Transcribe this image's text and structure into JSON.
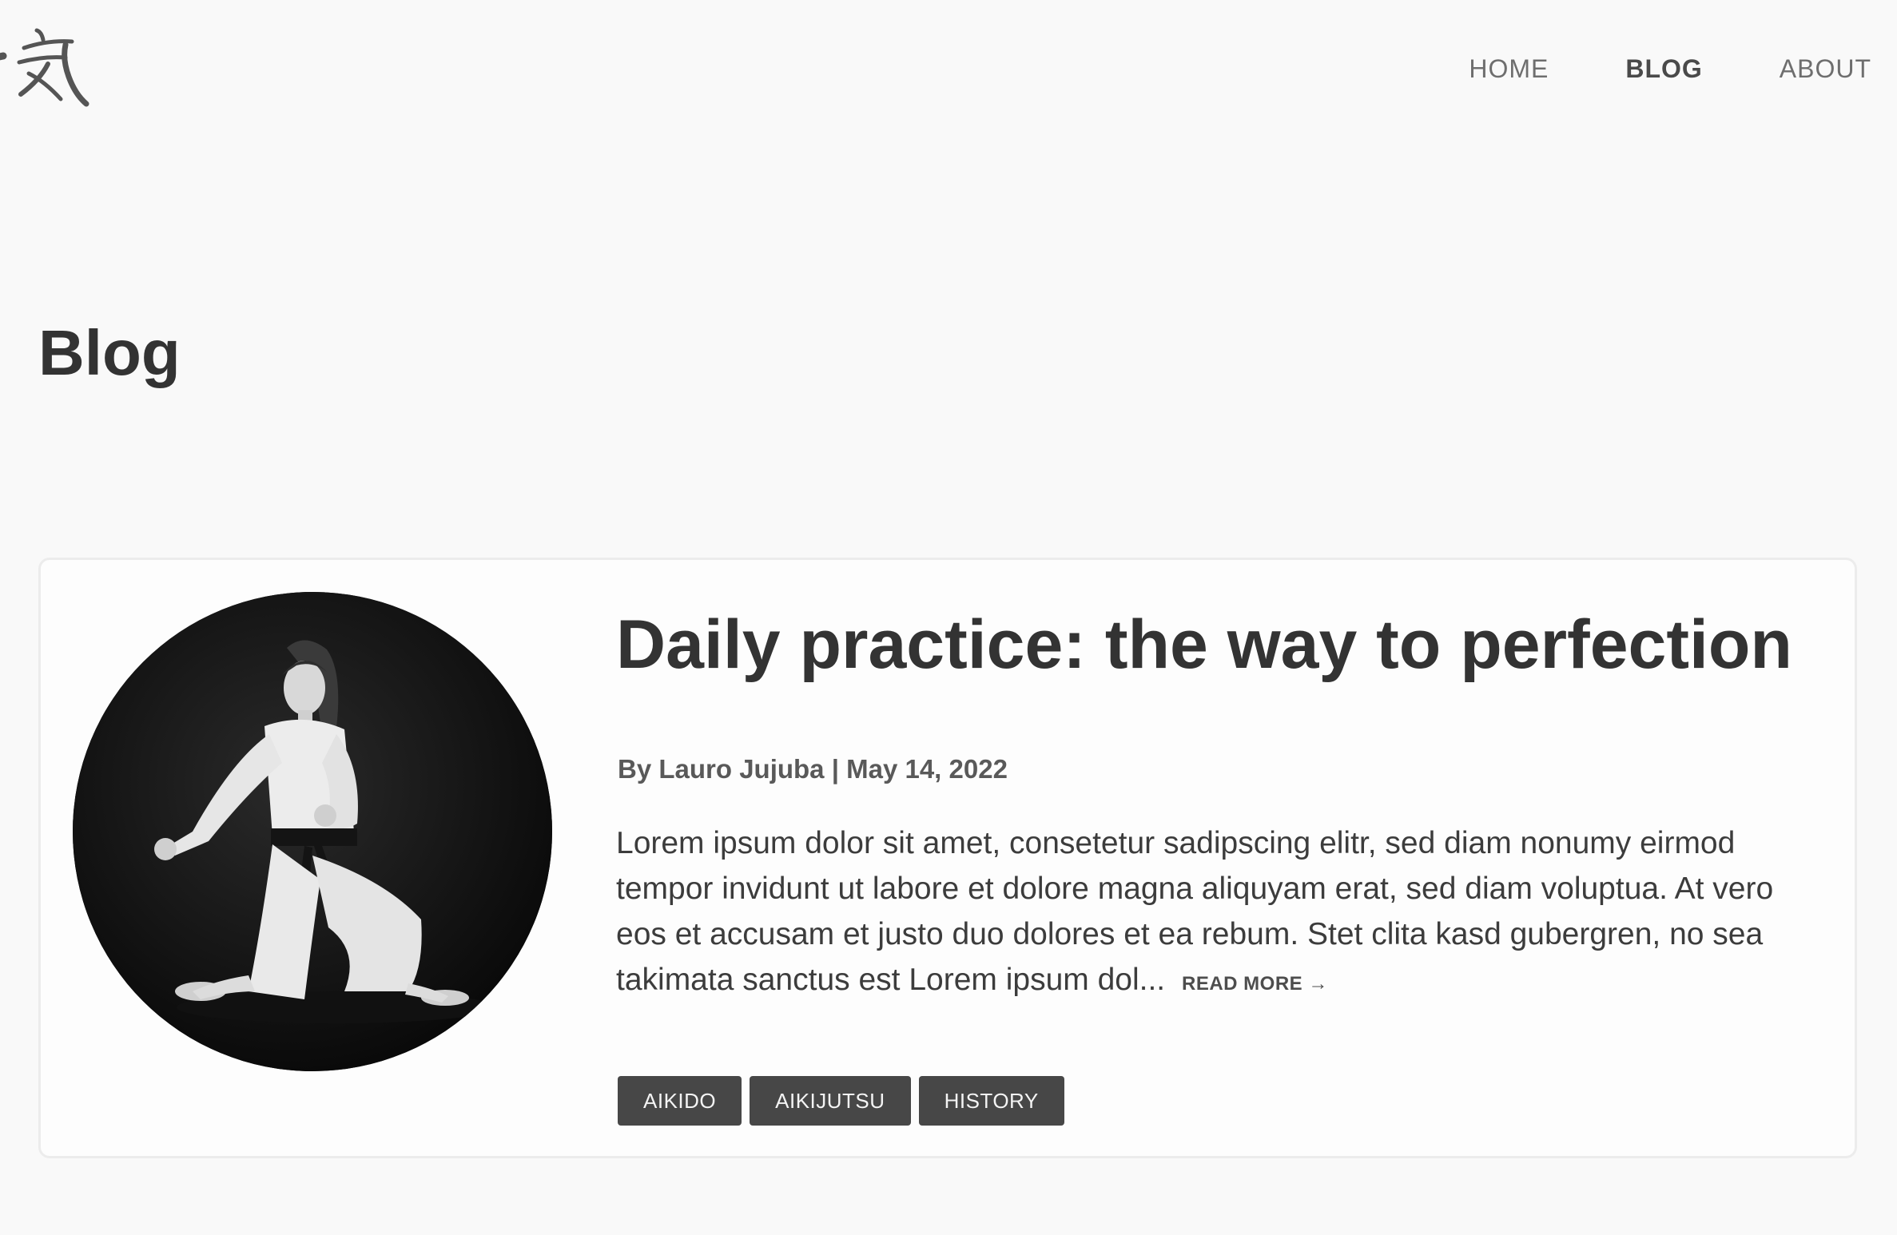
{
  "header": {
    "nav": [
      {
        "label": "HOME"
      },
      {
        "label": "BLOG"
      },
      {
        "label": "ABOUT"
      }
    ]
  },
  "page": {
    "title": "Blog"
  },
  "post": {
    "title": "Daily practice: the way to perfection",
    "meta": "By Lauro Jujuba | May 14, 2022",
    "excerpt": "Lorem ipsum dolor sit amet, consetetur sadipscing elitr, sed diam nonumy eirmod tempor invidunt ut labore et dolore magna aliquyam erat, sed diam voluptua. At vero eos et accusam et justo duo dolores et ea rebum. Stet clita kasd gubergren, no sea takimata sanctus est Lorem ipsum dol...",
    "read_more": "READ MORE →",
    "tags": [
      "AIKIDO",
      "AIKIJUTSU",
      "HISTORY"
    ]
  }
}
